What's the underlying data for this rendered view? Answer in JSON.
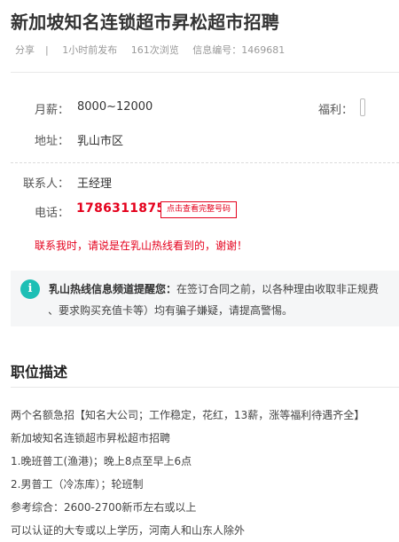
{
  "title": "新加坡知名连锁超市昇松超市招聘",
  "meta": {
    "share": "分享",
    "sep": "|",
    "posted": "1小时前发布",
    "views": "161次浏览",
    "info_id": "信息编号：1469681"
  },
  "salary": {
    "label": "月薪：",
    "value": "8000~12000"
  },
  "welfare": {
    "label": "福利："
  },
  "address": {
    "label": "地址：",
    "value": "乳山市区"
  },
  "contact": {
    "label": "联系人：",
    "value": "王经理"
  },
  "phone": {
    "label": "电话：",
    "value": "17863118756",
    "button": "点击查看完整号码"
  },
  "contact_note": "联系我时，请说是在乳山热线看到的，谢谢！",
  "warning": {
    "icon": "info-icon",
    "strong": "乳山热线信息频道提醒您：",
    "line1": "在签订合同之前，以各种理由收取非正规费",
    "line2": "费、要求购买充值卡等）均有骗子嫌疑，请提高警惕。"
  },
  "section_title": "职位描述",
  "description": [
    "两个名额急招【知名大公司；工作稳定，花红，13薪，涨等福利待遇齐全】",
    "新加坡知名连锁超市昇松超市招聘",
    "1.晚班普工(渔港)；晚上8点至早上6点",
    "2.男普工（冷冻库）；轮班制",
    "参考综合：2600-2700新币左右或以上",
    "可以认证的大专或以上学历，河南人和山东人除外"
  ],
  "colors": {
    "accent_red": "#e4001c",
    "icon_teal": "#1dbfb5"
  }
}
